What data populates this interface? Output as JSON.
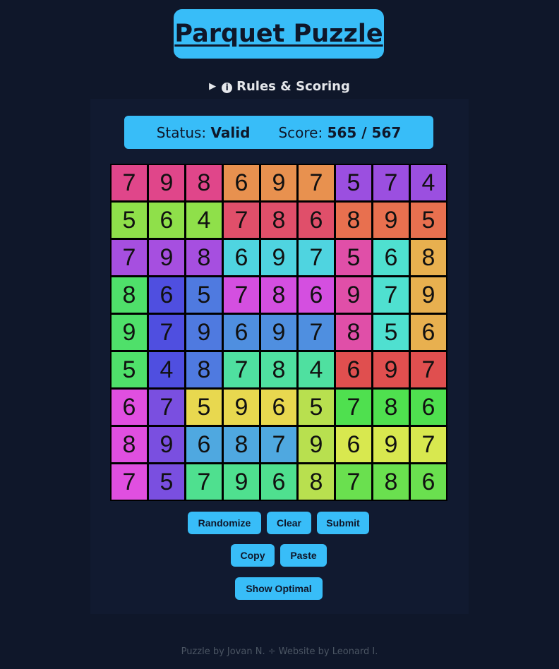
{
  "title": "Parquet Puzzle",
  "rules_label": "Rules & Scoring",
  "status": {
    "label": "Status:",
    "value": "Valid",
    "score_label": "Score:",
    "score_value": "565 / 567"
  },
  "grid": {
    "values": [
      [
        7,
        9,
        8,
        6,
        9,
        7,
        5,
        7,
        4
      ],
      [
        5,
        6,
        4,
        7,
        8,
        6,
        8,
        9,
        5
      ],
      [
        7,
        9,
        8,
        6,
        9,
        7,
        5,
        6,
        8
      ],
      [
        8,
        6,
        5,
        7,
        8,
        6,
        9,
        7,
        9
      ],
      [
        9,
        7,
        9,
        6,
        9,
        7,
        8,
        5,
        6
      ],
      [
        5,
        4,
        8,
        7,
        8,
        4,
        6,
        9,
        7
      ],
      [
        6,
        7,
        5,
        9,
        6,
        5,
        7,
        8,
        6
      ],
      [
        8,
        9,
        6,
        8,
        7,
        9,
        6,
        9,
        7
      ],
      [
        7,
        5,
        7,
        9,
        6,
        8,
        7,
        8,
        6
      ]
    ],
    "colors": [
      [
        "#e0468a",
        "#e0468a",
        "#e0468a",
        "#e8914f",
        "#e8914f",
        "#e8914f",
        "#9b4fe0",
        "#9b4fe0",
        "#9b4fe0"
      ],
      [
        "#8fe04a",
        "#8fe04a",
        "#8fe04a",
        "#e04f6a",
        "#e04f6a",
        "#e04f6a",
        "#e8704f",
        "#e8704f",
        "#e8704f"
      ],
      [
        "#a64fe0",
        "#a64fe0",
        "#a64fe0",
        "#4fd4e0",
        "#4fd4e0",
        "#4fd4e0",
        "#e04fa8",
        "#4fe0d0",
        "#e8b04f"
      ],
      [
        "#4fe06a",
        "#4f4fe0",
        "#4f7ae0",
        "#d44fe0",
        "#d44fe0",
        "#d44fe0",
        "#e04fa8",
        "#4fe0d0",
        "#e8b04f"
      ],
      [
        "#4fe06a",
        "#4f4fe0",
        "#4f7ae0",
        "#4f8fe0",
        "#4f8fe0",
        "#4f8fe0",
        "#e04fa8",
        "#4fe0d0",
        "#e8b04f"
      ],
      [
        "#4fe06a",
        "#4f4fe0",
        "#4f7ae0",
        "#4fe0a0",
        "#4fe0a0",
        "#4fe0a0",
        "#e04f4f",
        "#e04f4f",
        "#e04f4f"
      ],
      [
        "#e04fe0",
        "#7a4fe0",
        "#e8d84f",
        "#e8d84f",
        "#e8d84f",
        "#b8e04f",
        "#4fe04f",
        "#4fe04f",
        "#4fe04f"
      ],
      [
        "#e04fe0",
        "#7a4fe0",
        "#4fa8e0",
        "#4fa8e0",
        "#4fa8e0",
        "#b8e04f",
        "#d8e84f",
        "#d8e84f",
        "#d8e84f"
      ],
      [
        "#e04fe0",
        "#7a4fe0",
        "#4fe08f",
        "#4fe08f",
        "#4fe08f",
        "#b8e04f",
        "#6ae04f",
        "#6ae04f",
        "#6ae04f"
      ]
    ]
  },
  "buttons": {
    "randomize": "Randomize",
    "clear": "Clear",
    "submit": "Submit",
    "copy": "Copy",
    "paste": "Paste",
    "show_optimal": "Show Optimal"
  },
  "footer": "Puzzle by Jovan N. ÷ Website by Leonard I."
}
